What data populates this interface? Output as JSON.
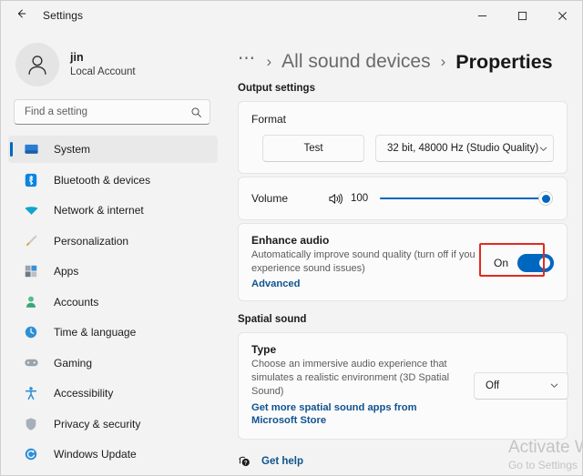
{
  "window": {
    "title": "Settings",
    "back_icon": "back-arrow-icon",
    "minimize_label": "─",
    "maximize_label": "□",
    "close_label": "✕"
  },
  "account": {
    "name": "jin",
    "type": "Local Account",
    "avatar_icon": "person-avatar-icon"
  },
  "search": {
    "placeholder": "Find a setting",
    "value": "",
    "icon": "search-icon"
  },
  "sidebar": {
    "items": [
      {
        "label": "System",
        "icon": "monitor-icon",
        "selected": true
      },
      {
        "label": "Bluetooth & devices",
        "icon": "bluetooth-icon",
        "selected": false
      },
      {
        "label": "Network & internet",
        "icon": "wifi-icon",
        "selected": false
      },
      {
        "label": "Personalization",
        "icon": "paintbrush-icon",
        "selected": false
      },
      {
        "label": "Apps",
        "icon": "apps-grid-icon",
        "selected": false
      },
      {
        "label": "Accounts",
        "icon": "person-icon",
        "selected": false
      },
      {
        "label": "Time & language",
        "icon": "clock-globe-icon",
        "selected": false
      },
      {
        "label": "Gaming",
        "icon": "gamepad-icon",
        "selected": false
      },
      {
        "label": "Accessibility",
        "icon": "accessibility-person-icon",
        "selected": false
      },
      {
        "label": "Privacy & security",
        "icon": "shield-icon",
        "selected": false
      },
      {
        "label": "Windows Update",
        "icon": "update-refresh-icon",
        "selected": false
      }
    ]
  },
  "breadcrumb": {
    "overflow": "⋯",
    "separator": "›",
    "parent": "All sound devices",
    "current": "Properties"
  },
  "output_settings": {
    "heading": "Output settings",
    "format": {
      "label": "Format",
      "test_button": "Test",
      "value": "32 bit, 48000 Hz (Studio Quality)",
      "chevron_icon": "chevron-down-icon"
    },
    "volume": {
      "label": "Volume",
      "speaker_icon": "speaker-volume-icon",
      "value": "100",
      "percent": 100
    },
    "enhance_audio": {
      "title": "Enhance audio",
      "description": "Automatically improve sound quality (turn off if you experience sound issues)",
      "link": "Advanced",
      "toggle_label": "On",
      "toggle_on": true,
      "highlight_color": "#e02b20"
    }
  },
  "spatial_sound": {
    "heading": "Spatial sound",
    "type": {
      "title": "Type",
      "description": "Choose an immersive audio experience that simulates a realistic environment (3D Spatial Sound)",
      "link": "Get more spatial sound apps from Microsoft Store",
      "value": "Off",
      "chevron_icon": "chevron-down-icon"
    }
  },
  "footer": {
    "help_label": "Get help",
    "help_icon": "help-question-icon"
  },
  "watermark": {
    "line1": "Activate Wi",
    "line2": "Go to Settings"
  },
  "colors": {
    "accent": "#0067c0",
    "link": "#10538f",
    "highlight": "#e02b20",
    "window_bg": "#f3f3f3",
    "card_bg": "#fbfbfb"
  }
}
